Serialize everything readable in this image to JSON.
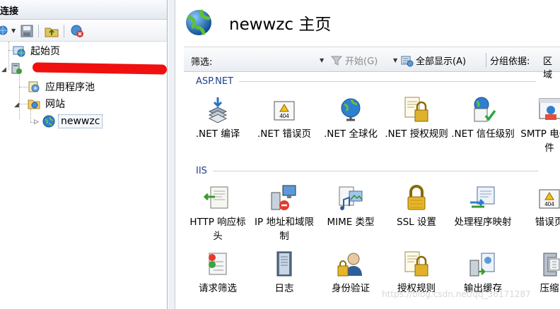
{
  "left_pane": {
    "header": "连接",
    "tree": {
      "start_page": "起始页",
      "app_pools": "应用程序池",
      "sites": "网站",
      "site_newwzc": "newwzc"
    }
  },
  "main": {
    "title": "newwzc 主页",
    "filter": {
      "label": "筛选:",
      "start": "开始(G)",
      "show_all": "全部显示(A)",
      "group_by_label": "分组依据:",
      "group_by_value": "区域"
    },
    "groups": [
      {
        "name": "ASP.NET",
        "items": [
          ".NET 编译",
          ".NET 错误页",
          ".NET 全球化",
          ".NET 授权规则",
          ".NET 信任级别",
          "SMTP 电子邮件"
        ]
      },
      {
        "name": "IIS",
        "items": [
          "HTTP 响应标头",
          "IP 地址和域限制",
          "MIME 类型",
          "SSL 设置",
          "处理程序映射",
          "错误页"
        ]
      }
    ],
    "row3": [
      "请求筛选",
      "日志",
      "身份验证",
      "授权规则",
      "输出缓存",
      "压缩"
    ]
  },
  "watermark": "https://blog.csdn.net/qq_36171287",
  "colors": {
    "group_heading": "#1e3f8e",
    "header_gradient_top": "#fafbfd",
    "header_gradient_bottom": "#e4e9f1"
  }
}
